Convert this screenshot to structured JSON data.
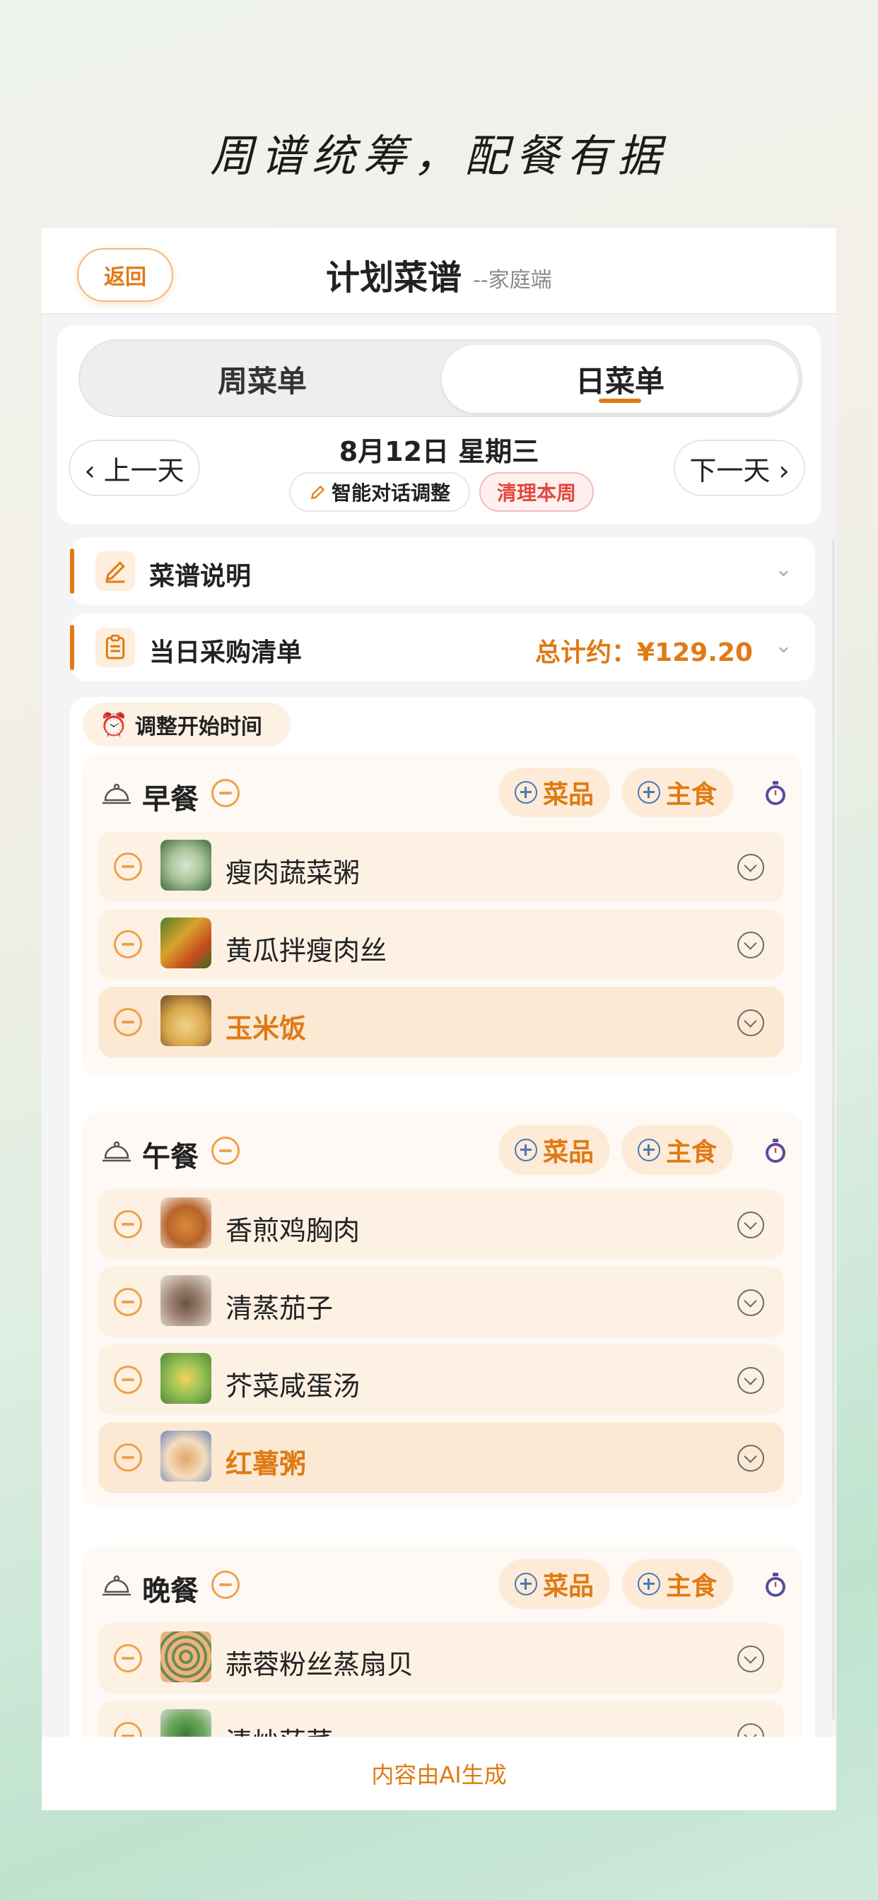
{
  "headline": "周谱统筹，配餐有据",
  "nav": {
    "back": "返回",
    "title": "计划菜谱",
    "subtitle": "--家庭端"
  },
  "tabs": [
    {
      "label": "周菜单"
    },
    {
      "label": "日菜单",
      "active": true
    }
  ],
  "date": {
    "prev": "‹ 上一天",
    "current": "8月12日 星期三",
    "next": "下一天 ›"
  },
  "chips": {
    "ai_adjust": "智能对话调整",
    "clear_week": "清理本周"
  },
  "recipe_notes": {
    "label": "菜谱说明"
  },
  "shopping": {
    "label": "当日采购清单",
    "total": "总计约：¥129.20"
  },
  "adjust_time": "调整开始时间",
  "add_buttons": {
    "dish": "菜品",
    "staple": "主食"
  },
  "meals": [
    {
      "name": "早餐",
      "dishes": [
        {
          "name": "瘦肉蔬菜粥",
          "staple": false
        },
        {
          "name": "黄瓜拌瘦肉丝",
          "staple": false
        },
        {
          "name": "玉米饭",
          "staple": true
        }
      ]
    },
    {
      "name": "午餐",
      "dishes": [
        {
          "name": "香煎鸡胸肉",
          "staple": false
        },
        {
          "name": "清蒸茄子",
          "staple": false
        },
        {
          "name": "芥菜咸蛋汤",
          "staple": false
        },
        {
          "name": "红薯粥",
          "staple": true
        }
      ]
    },
    {
      "name": "晚餐",
      "dishes": [
        {
          "name": "蒜蓉粉丝蒸扇贝",
          "staple": false
        },
        {
          "name": "清炒菠菜",
          "staple": false
        }
      ]
    }
  ],
  "footer": "内容由AI生成",
  "colors": {
    "accent": "#e07a14",
    "danger": "#e2483d"
  }
}
